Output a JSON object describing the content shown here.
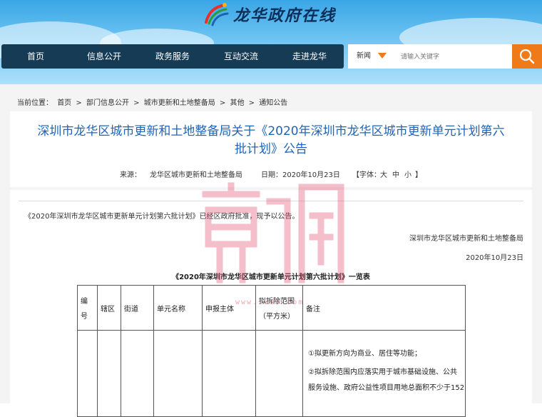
{
  "site": {
    "logo_text": "龙华政府在线"
  },
  "nav": {
    "items": [
      "首页",
      "信息公开",
      "政务服务",
      "互动交流",
      "走进龙华"
    ]
  },
  "search": {
    "category": "新闻",
    "placeholder": "请输入关键字"
  },
  "breadcrumb": {
    "label": "当前位置：",
    "items": [
      "首页",
      "部门信息公开",
      "城市更新和土地整备局",
      "其他",
      "通知公告"
    ],
    "separator": ">"
  },
  "article": {
    "title_line1": "深圳市龙华区城市更新和土地整备局关于《2020年深圳市龙华区城市更新单元计划第六",
    "title_line2": "批计划》公告",
    "source_label": "来源：",
    "source": "龙华区城市更新和土地整备局",
    "date": "日期：2020年10月23日",
    "font_label": "【字体：",
    "font_sizes": [
      "大",
      "中",
      "小"
    ],
    "font_close": "】",
    "body": "《2020年深圳市龙华区城市更新单元计划第六批计划》已经区政府批准，现予以公告。",
    "signature": "深圳市龙华区城市更新和土地整备局",
    "sign_date": "2020年10月23日",
    "table_title": "《2020年深圳市龙华区城市更新单元计划第六批计划》一览表"
  },
  "table": {
    "headers": {
      "number_a": "编",
      "number_b": "号",
      "district": "辖区",
      "street": "街道",
      "unit_name": "单元名称",
      "applicant": "申报主体",
      "area_a": "拟拆除范围",
      "area_b": "（平方米）",
      "remarks": "备注"
    },
    "remarks_lines": [
      "①拟更新方向为商业、居住等功能；",
      "②拟拆除范围内应落实用于城市基础设施、公共",
      "服务设施、政府公益性项目用地总面积不少于152"
    ]
  },
  "watermark": {
    "url": "www.1wan.com"
  },
  "colors": {
    "nav_bg": "#163b54",
    "accent": "#ef7a1a",
    "title_blue": "#1f64b6"
  }
}
